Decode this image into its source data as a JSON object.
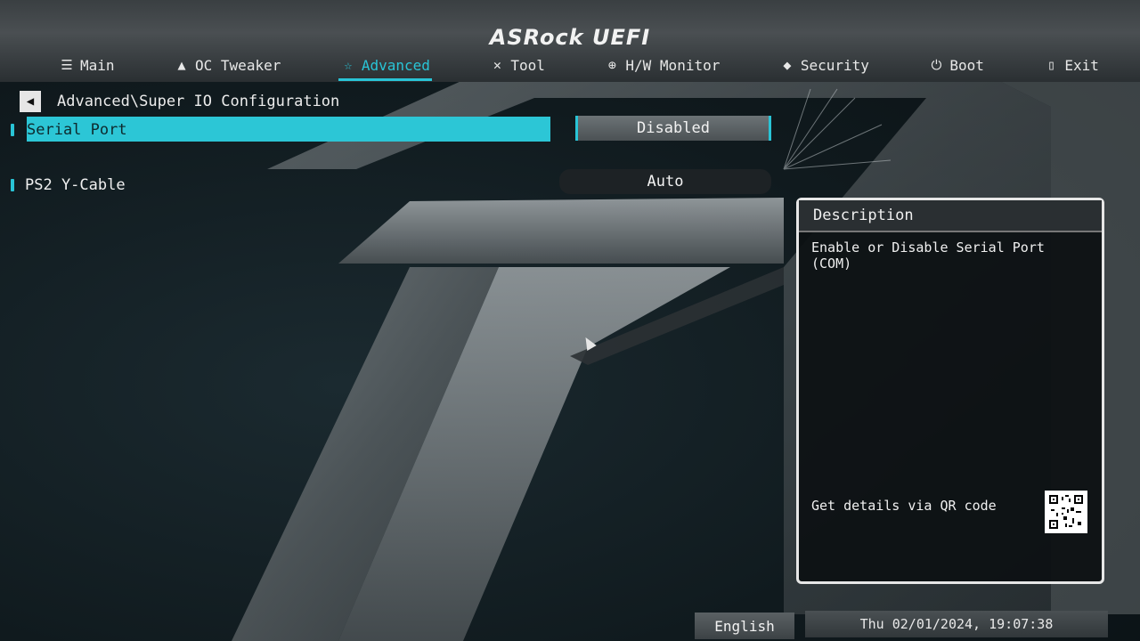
{
  "brand": "ASRock UEFI",
  "nav": [
    {
      "label": "Main",
      "icon": "list-icon"
    },
    {
      "label": "OC Tweaker",
      "icon": "rocket-icon"
    },
    {
      "label": "Advanced",
      "icon": "star-icon",
      "active": true
    },
    {
      "label": "Tool",
      "icon": "tools-icon"
    },
    {
      "label": "H/W Monitor",
      "icon": "monitor-icon"
    },
    {
      "label": "Security",
      "icon": "shield-icon"
    },
    {
      "label": "Boot",
      "icon": "power-icon"
    },
    {
      "label": "Exit",
      "icon": "exit-icon"
    }
  ],
  "breadcrumb": "Advanced\\Super IO Configuration",
  "settings": [
    {
      "label": "Serial Port",
      "value": "Disabled",
      "selected": true
    },
    {
      "label": "PS2 Y-Cable",
      "value": "Auto",
      "selected": false
    }
  ],
  "description": {
    "title": "Description",
    "text": "Enable or Disable Serial Port (COM)",
    "qr_label": "Get details via QR code"
  },
  "footer": {
    "language": "English",
    "datetime": "Thu 02/01/2024, 19:07:38"
  },
  "colors": {
    "accent": "#29c4d6",
    "highlight": "#2cc6d6"
  }
}
